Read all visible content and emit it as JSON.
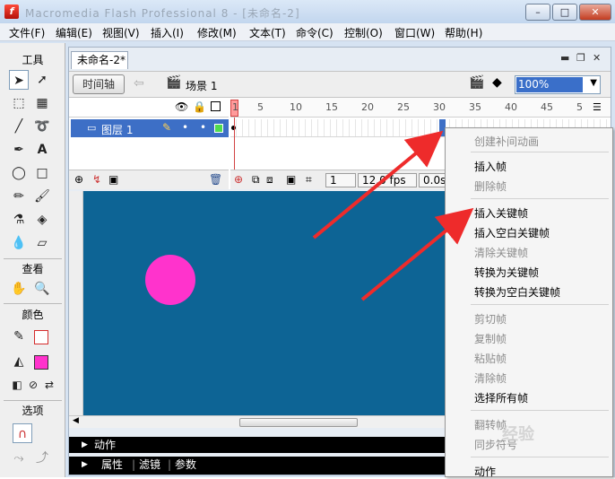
{
  "window": {
    "title": "Macromedia Flash Professional 8 - [未命名-2]",
    "minimize": "–",
    "maximize": "□",
    "close": "✕"
  },
  "menubar": [
    "文件(F)",
    "编辑(E)",
    "视图(V)",
    "插入(I)",
    "修改(M)",
    "文本(T)",
    "命令(C)",
    "控制(O)",
    "窗口(W)",
    "帮助(H)"
  ],
  "tools": {
    "title": "工具",
    "view_title": "查看",
    "colors_title": "颜色",
    "options_title": "选项",
    "stroke_color": "#d42b2b",
    "fill_color": "#ff33cc"
  },
  "document": {
    "tab": "未命名-2*",
    "timeline_button": "时间轴",
    "scene": "场景 1",
    "zoom": "100%",
    "layer_name": "图层 1",
    "ruler_ticks": [
      "1",
      "5",
      "10",
      "15",
      "20",
      "25",
      "30",
      "35",
      "40",
      "45",
      "5"
    ],
    "current_frame": "1",
    "fps": "12.0 fps",
    "elapsed": "0.0s",
    "stage_color": "#0d6495",
    "circle_color": "#ff33cc"
  },
  "panels": {
    "actions": "动作",
    "properties": "属性",
    "filters": "滤镜",
    "params": "参数"
  },
  "context_menu": [
    {
      "label": "创建补间动画",
      "enabled": false
    },
    {
      "label": "插入帧",
      "enabled": true
    },
    {
      "label": "删除帧",
      "enabled": false
    },
    {
      "label": "插入关键帧",
      "enabled": true
    },
    {
      "label": "插入空白关键帧",
      "enabled": true
    },
    {
      "label": "清除关键帧",
      "enabled": false
    },
    {
      "label": "转换为关键帧",
      "enabled": true
    },
    {
      "label": "转换为空白关键帧",
      "enabled": true
    },
    {
      "label": "剪切帧",
      "enabled": false
    },
    {
      "label": "复制帧",
      "enabled": false
    },
    {
      "label": "粘贴帧",
      "enabled": false
    },
    {
      "label": "清除帧",
      "enabled": false
    },
    {
      "label": "选择所有帧",
      "enabled": true
    },
    {
      "label": "翻转帧",
      "enabled": false
    },
    {
      "label": "同步符号",
      "enabled": false
    },
    {
      "label": "动作",
      "enabled": true
    }
  ],
  "watermark": "经验"
}
